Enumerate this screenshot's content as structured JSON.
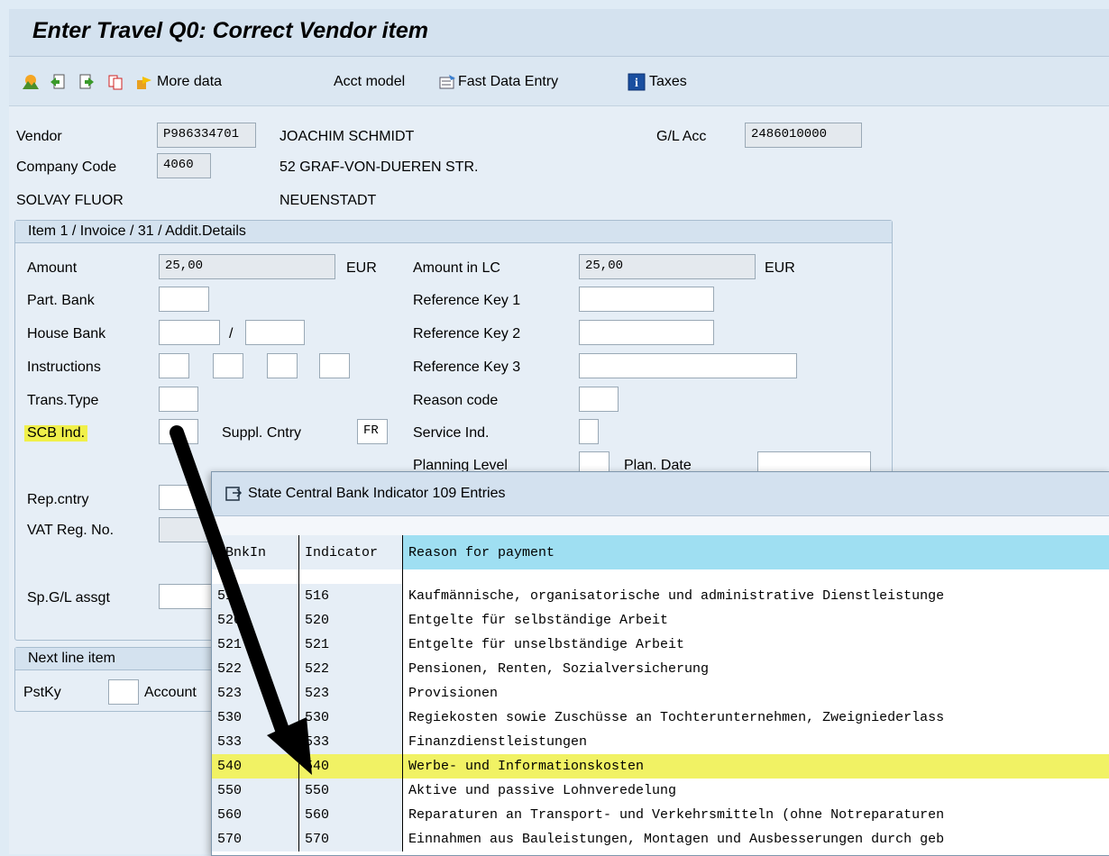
{
  "window": {
    "title": "Enter Travel Q0: Correct Vendor item"
  },
  "toolbar": {
    "more_data": "More data",
    "acct_model": "Acct model",
    "fast_data_entry": "Fast Data Entry",
    "taxes": "Taxes"
  },
  "header": {
    "vendor_label": "Vendor",
    "vendor_value": "P986334701",
    "vendor_name": "JOACHIM SCHMIDT",
    "gl_label": "G/L Acc",
    "gl_value": "2486010000",
    "company_label": "Company Code",
    "company_value": "4060",
    "street": "52 GRAF-VON-DUEREN STR.",
    "company_name": "SOLVAY FLUOR",
    "city": "NEUENSTADT"
  },
  "item": {
    "group_title": "Item 1 / Invoice / 31 / Addit.Details",
    "amount_label": "Amount",
    "amount_value": "25,00",
    "amount_currency": "EUR",
    "amount_lc_label": "Amount in LC",
    "amount_lc_value": "25,00",
    "amount_lc_currency": "EUR",
    "part_bank_label": "Part. Bank",
    "ref_key1_label": "Reference Key 1",
    "house_bank_label": "House Bank",
    "house_bank_sep": "/",
    "ref_key2_label": "Reference Key 2",
    "instructions_label": "Instructions",
    "ref_key3_label": "Reference Key 3",
    "trans_type_label": "Trans.Type",
    "reason_code_label": "Reason code",
    "scb_label": "SCB Ind.",
    "suppl_cntry_label": "Suppl. Cntry",
    "suppl_cntry_value": "FR",
    "service_ind_label": "Service Ind.",
    "planning_level_label": "Planning Level",
    "plan_date_label": "Plan. Date",
    "rep_cntry_label": "Rep.cntry",
    "vat_reg_label": "VAT Reg. No.",
    "sp_gl_label": "Sp.G/L assgt"
  },
  "next_item": {
    "group_title": "Next line item",
    "pstky_label": "PstKy",
    "account_label": "Account"
  },
  "popup": {
    "title": "State Central Bank Indicator 109 Entries",
    "columns": [
      "CBnkIn",
      "Indicator",
      "Reason for payment"
    ],
    "rows": [
      {
        "c1": "516",
        "c2": "516",
        "c3": "Kaufmännische, organisatorische und administrative Dienstleistunge",
        "selected": false
      },
      {
        "c1": "520",
        "c2": "520",
        "c3": "Entgelte für selbständige Arbeit",
        "selected": false
      },
      {
        "c1": "521",
        "c2": "521",
        "c3": "Entgelte für unselbständige Arbeit",
        "selected": false
      },
      {
        "c1": "522",
        "c2": "522",
        "c3": "Pensionen, Renten, Sozialversicherung",
        "selected": false
      },
      {
        "c1": "523",
        "c2": "523",
        "c3": "Provisionen",
        "selected": false
      },
      {
        "c1": "530",
        "c2": "530",
        "c3": "Regiekosten sowie Zuschüsse an Tochterunternehmen, Zweigniederlass",
        "selected": false
      },
      {
        "c1": "533",
        "c2": "533",
        "c3": "Finanzdienstleistungen",
        "selected": false
      },
      {
        "c1": "540",
        "c2": "540",
        "c3": "Werbe- und Informationskosten",
        "selected": true
      },
      {
        "c1": "550",
        "c2": "550",
        "c3": "Aktive und passive Lohnveredelung",
        "selected": false
      },
      {
        "c1": "560",
        "c2": "560",
        "c3": "Reparaturen an Transport- und Verkehrsmitteln (ohne Notreparaturen",
        "selected": false
      },
      {
        "c1": "570",
        "c2": "570",
        "c3": "Einnahmen aus Bauleistungen, Montagen und Ausbesserungen durch geb",
        "selected": false
      }
    ]
  },
  "colors": {
    "highlight": "#f0f04a",
    "grid_header": "#9fdff2",
    "arrow": "#000000"
  }
}
